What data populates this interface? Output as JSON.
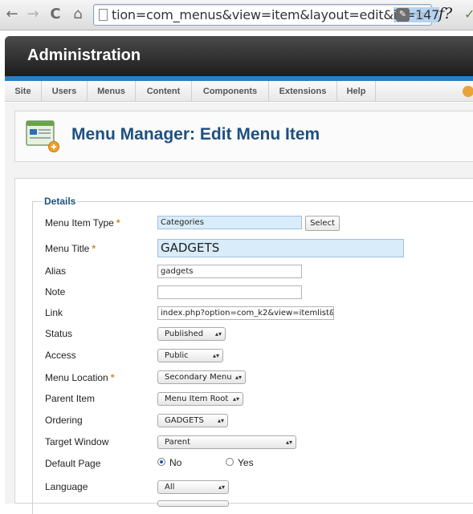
{
  "browser": {
    "back_icon": "←",
    "forward_icon": "→",
    "reload_icon": "C",
    "home_icon": "⌂",
    "url_prefix": "tion=com_menus&view=item&layout=edit&",
    "url_selected": "id=147",
    "star_icon": "☆",
    "key_icon": "✎",
    "ext_f": "f?",
    "ext_g": "✓"
  },
  "header": {
    "title": "Administration"
  },
  "menubar": {
    "items": [
      "Site",
      "Users",
      "Menus",
      "Content",
      "Components",
      "Extensions",
      "Help"
    ]
  },
  "toolbar": {
    "title": "Menu Manager: Edit Menu Item"
  },
  "form": {
    "legend": "Details",
    "menu_item_type": {
      "label": "Menu Item Type",
      "required": "*",
      "value": "Categories",
      "button": "Select"
    },
    "menu_title": {
      "label": "Menu Title",
      "required": "*",
      "value": "GADGETS"
    },
    "alias": {
      "label": "Alias",
      "value": "gadgets"
    },
    "note": {
      "label": "Note",
      "value": ""
    },
    "link": {
      "label": "Link",
      "value": "index.php?option=com_k2&view=itemlist&la"
    },
    "status": {
      "label": "Status",
      "value": "Published"
    },
    "access": {
      "label": "Access",
      "value": "Public"
    },
    "menu_location": {
      "label": "Menu Location",
      "required": "*",
      "value": "Secondary Menu"
    },
    "parent_item": {
      "label": "Parent Item",
      "value": "Menu Item Root"
    },
    "ordering": {
      "label": "Ordering",
      "value": "GADGETS"
    },
    "target_window": {
      "label": "Target Window",
      "value": "Parent"
    },
    "default_page": {
      "label": "Default Page",
      "options": [
        "No",
        "Yes"
      ],
      "selected": "No"
    },
    "language": {
      "label": "Language",
      "value": "All"
    }
  },
  "colors": {
    "accent": "#1f4f81",
    "stripe": "#2c7fc3",
    "required": "#e67e22"
  }
}
